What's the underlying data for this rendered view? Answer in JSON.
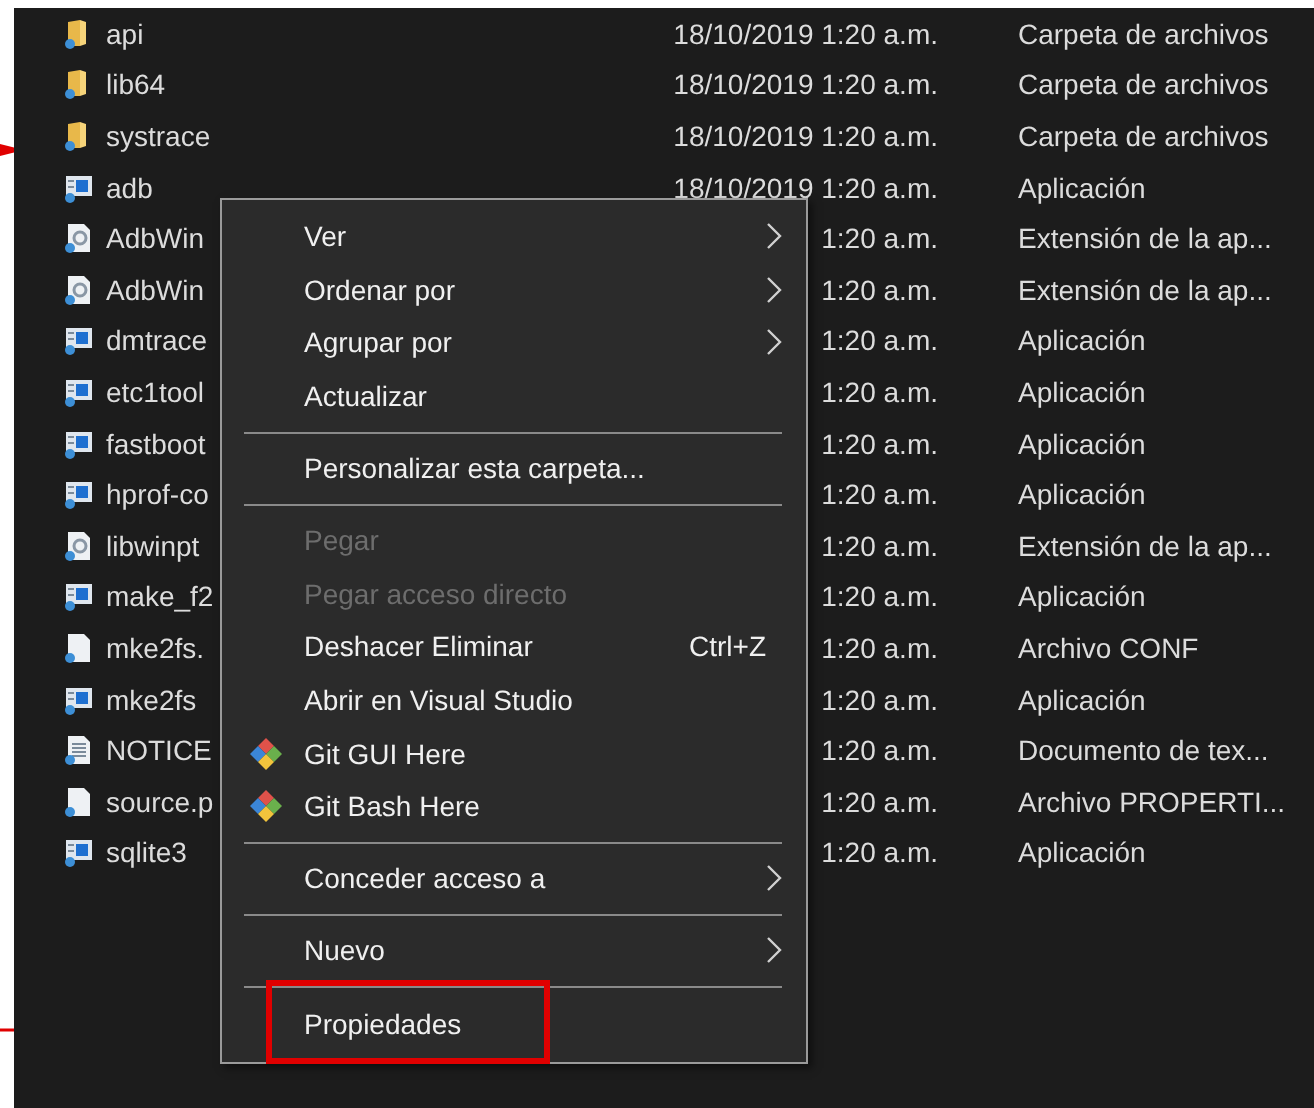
{
  "files": [
    {
      "name": "api",
      "date": "18/10/2019 1:20 a.m.",
      "type": "Carpeta de archivos",
      "kind": "folder"
    },
    {
      "name": "lib64",
      "date": "18/10/2019 1:20 a.m.",
      "type": "Carpeta de archivos",
      "kind": "folder"
    },
    {
      "name": "systrace",
      "date": "18/10/2019 1:20 a.m.",
      "type": "Carpeta de archivos",
      "kind": "folder"
    },
    {
      "name": "adb",
      "date": "18/10/2019 1:20 a.m.",
      "type": "Aplicación",
      "kind": "app"
    },
    {
      "name": "AdbWin",
      "date": "1:20 a.m.",
      "type": "Extensión de la ap...",
      "kind": "dll"
    },
    {
      "name": "AdbWin",
      "date": "1:20 a.m.",
      "type": "Extensión de la ap...",
      "kind": "dll"
    },
    {
      "name": "dmtrace",
      "date": "1:20 a.m.",
      "type": "Aplicación",
      "kind": "app"
    },
    {
      "name": "etc1tool",
      "date": "1:20 a.m.",
      "type": "Aplicación",
      "kind": "app"
    },
    {
      "name": "fastboot",
      "date": "1:20 a.m.",
      "type": "Aplicación",
      "kind": "app"
    },
    {
      "name": "hprof-co",
      "date": "1:20 a.m.",
      "type": "Aplicación",
      "kind": "app"
    },
    {
      "name": "libwinpt",
      "date": "1:20 a.m.",
      "type": "Extensión de la ap...",
      "kind": "dll"
    },
    {
      "name": "make_f2",
      "date": "1:20 a.m.",
      "type": "Aplicación",
      "kind": "app"
    },
    {
      "name": "mke2fs.",
      "date": "1:20 a.m.",
      "type": "Archivo CONF",
      "kind": "file"
    },
    {
      "name": "mke2fs",
      "date": "1:20 a.m.",
      "type": "Aplicación",
      "kind": "app"
    },
    {
      "name": "NOTICE",
      "date": "1:20 a.m.",
      "type": "Documento de tex...",
      "kind": "text"
    },
    {
      "name": "source.p",
      "date": "1:20 a.m.",
      "type": "Archivo PROPERTI...",
      "kind": "file"
    },
    {
      "name": "sqlite3",
      "date": "1:20 a.m.",
      "type": "Aplicación",
      "kind": "app"
    }
  ],
  "context_menu": [
    {
      "kind": "item",
      "label": "Ver",
      "submenu": true,
      "disabled": false,
      "highlighted": false
    },
    {
      "kind": "item",
      "label": "Ordenar por",
      "submenu": true,
      "disabled": false,
      "highlighted": false
    },
    {
      "kind": "item",
      "label": "Agrupar por",
      "submenu": true,
      "disabled": false,
      "highlighted": false
    },
    {
      "kind": "item",
      "label": "Actualizar",
      "submenu": false,
      "disabled": false,
      "highlighted": false
    },
    {
      "kind": "separator"
    },
    {
      "kind": "item",
      "label": "Personalizar esta carpeta...",
      "submenu": false,
      "disabled": false,
      "highlighted": false
    },
    {
      "kind": "separator"
    },
    {
      "kind": "item",
      "label": "Pegar",
      "submenu": false,
      "disabled": true,
      "highlighted": false
    },
    {
      "kind": "item",
      "label": "Pegar acceso directo",
      "submenu": false,
      "disabled": true,
      "highlighted": false
    },
    {
      "kind": "item",
      "label": "Deshacer Eliminar",
      "shortcut": "Ctrl+Z",
      "submenu": false,
      "disabled": false,
      "highlighted": false
    },
    {
      "kind": "item",
      "label": "Abrir en Visual Studio",
      "submenu": false,
      "disabled": false,
      "highlighted": false
    },
    {
      "kind": "git_item",
      "label": "Git GUI Here",
      "submenu": false,
      "disabled": false,
      "highlighted": false
    },
    {
      "kind": "git_item",
      "label": "Git Bash Here",
      "submenu": false,
      "disabled": false,
      "highlighted": false
    },
    {
      "kind": "separator"
    },
    {
      "kind": "item",
      "label": "Conceder acceso a",
      "submenu": true,
      "disabled": false,
      "highlighted": false
    },
    {
      "kind": "separator"
    },
    {
      "kind": "item",
      "label": "Nuevo",
      "submenu": true,
      "disabled": false,
      "highlighted": false
    },
    {
      "kind": "separator"
    },
    {
      "kind": "item",
      "label": "Propiedades",
      "submenu": false,
      "disabled": false,
      "highlighted": true
    }
  ]
}
